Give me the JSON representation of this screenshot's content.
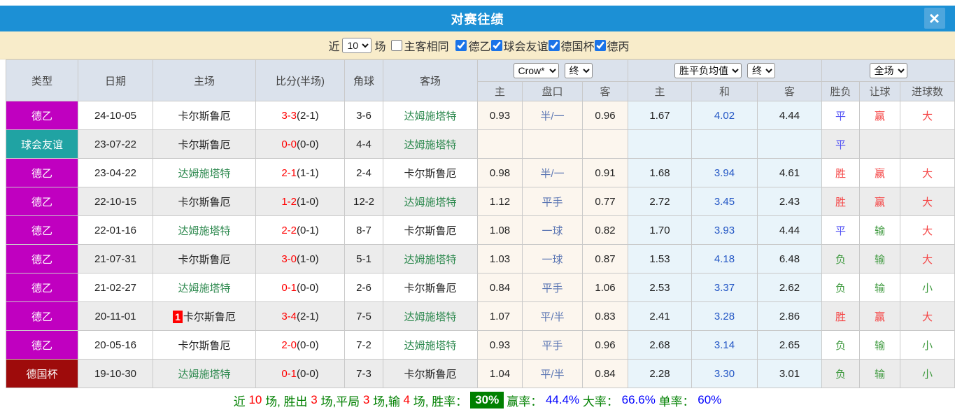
{
  "title": "对赛往绩",
  "close_glyph": "×",
  "filter": {
    "recent_label": "近",
    "recent_count": "10",
    "unit_label": "场",
    "same_home_away": {
      "label": "主客相同",
      "checked": false
    },
    "competitions": [
      {
        "label": "德乙",
        "checked": true
      },
      {
        "label": "球会友谊",
        "checked": true
      },
      {
        "label": "德国杯",
        "checked": true
      },
      {
        "label": "德丙",
        "checked": true
      }
    ]
  },
  "table": {
    "columns": {
      "type": "类型",
      "date": "日期",
      "home": "主场",
      "score": "比分(半场)",
      "corners": "角球",
      "away": "客场",
      "odds_home": "主",
      "odds_line": "盘口",
      "odds_away": "客",
      "avg_home": "主",
      "avg_draw": "和",
      "avg_away": "客",
      "result_wl": "胜负",
      "result_handicap": "让球",
      "result_goals": "进球数"
    },
    "selectors": {
      "bookmaker": "Crow*",
      "bookmaker_time": "终",
      "avg_type": "胜平负均值",
      "avg_time": "终",
      "scope": "全场"
    },
    "green_team": "达姆施塔特",
    "rows": [
      {
        "league": "德乙",
        "league_color": "#c000c0",
        "date": "24-10-05",
        "home": "卡尔斯鲁厄",
        "home_badge": "",
        "score": "3-3",
        "half": "(2-1)",
        "corners": "3-6",
        "away": "达姆施塔特",
        "odds_home": "0.93",
        "odds_line": "半/一",
        "odds_away": "0.96",
        "avg_home": "1.67",
        "avg_draw": "4.02",
        "avg_away": "4.44",
        "result_wl": "平",
        "result_handicap": "赢",
        "result_goals": "大"
      },
      {
        "league": "球会友谊",
        "league_color": "#20a3a3",
        "date": "23-07-22",
        "home": "卡尔斯鲁厄",
        "home_badge": "",
        "score": "0-0",
        "half": "(0-0)",
        "corners": "4-4",
        "away": "达姆施塔特",
        "odds_home": "",
        "odds_line": "",
        "odds_away": "",
        "avg_home": "",
        "avg_draw": "",
        "avg_away": "",
        "result_wl": "平",
        "result_handicap": "",
        "result_goals": ""
      },
      {
        "league": "德乙",
        "league_color": "#c000c0",
        "date": "23-04-22",
        "home": "达姆施塔特",
        "home_badge": "",
        "score": "2-1",
        "half": "(1-1)",
        "corners": "2-4",
        "away": "卡尔斯鲁厄",
        "odds_home": "0.98",
        "odds_line": "半/一",
        "odds_away": "0.91",
        "avg_home": "1.68",
        "avg_draw": "3.94",
        "avg_away": "4.61",
        "result_wl": "胜",
        "result_handicap": "赢",
        "result_goals": "大"
      },
      {
        "league": "德乙",
        "league_color": "#c000c0",
        "date": "22-10-15",
        "home": "卡尔斯鲁厄",
        "home_badge": "",
        "score": "1-2",
        "half": "(1-0)",
        "corners": "12-2",
        "away": "达姆施塔特",
        "odds_home": "1.12",
        "odds_line": "平手",
        "odds_away": "0.77",
        "avg_home": "2.72",
        "avg_draw": "3.45",
        "avg_away": "2.43",
        "result_wl": "胜",
        "result_handicap": "赢",
        "result_goals": "大"
      },
      {
        "league": "德乙",
        "league_color": "#c000c0",
        "date": "22-01-16",
        "home": "达姆施塔特",
        "home_badge": "",
        "score": "2-2",
        "half": "(0-1)",
        "corners": "8-7",
        "away": "卡尔斯鲁厄",
        "odds_home": "1.08",
        "odds_line": "一球",
        "odds_away": "0.82",
        "avg_home": "1.70",
        "avg_draw": "3.93",
        "avg_away": "4.44",
        "result_wl": "平",
        "result_handicap": "输",
        "result_goals": "大"
      },
      {
        "league": "德乙",
        "league_color": "#c000c0",
        "date": "21-07-31",
        "home": "卡尔斯鲁厄",
        "home_badge": "",
        "score": "3-0",
        "half": "(1-0)",
        "corners": "5-1",
        "away": "达姆施塔特",
        "odds_home": "1.03",
        "odds_line": "一球",
        "odds_away": "0.87",
        "avg_home": "1.53",
        "avg_draw": "4.18",
        "avg_away": "6.48",
        "result_wl": "负",
        "result_handicap": "输",
        "result_goals": "大"
      },
      {
        "league": "德乙",
        "league_color": "#c000c0",
        "date": "21-02-27",
        "home": "达姆施塔特",
        "home_badge": "",
        "score": "0-1",
        "half": "(0-0)",
        "corners": "2-6",
        "away": "卡尔斯鲁厄",
        "odds_home": "0.84",
        "odds_line": "平手",
        "odds_away": "1.06",
        "avg_home": "2.53",
        "avg_draw": "3.37",
        "avg_away": "2.62",
        "result_wl": "负",
        "result_handicap": "输",
        "result_goals": "小"
      },
      {
        "league": "德乙",
        "league_color": "#c000c0",
        "date": "20-11-01",
        "home": "卡尔斯鲁厄",
        "home_badge": "1",
        "score": "3-4",
        "half": "(2-1)",
        "corners": "7-5",
        "away": "达姆施塔特",
        "odds_home": "1.07",
        "odds_line": "平/半",
        "odds_away": "0.83",
        "avg_home": "2.41",
        "avg_draw": "3.28",
        "avg_away": "2.86",
        "result_wl": "胜",
        "result_handicap": "赢",
        "result_goals": "大"
      },
      {
        "league": "德乙",
        "league_color": "#c000c0",
        "date": "20-05-16",
        "home": "卡尔斯鲁厄",
        "home_badge": "",
        "score": "2-0",
        "half": "(0-0)",
        "corners": "7-2",
        "away": "达姆施塔特",
        "odds_home": "0.93",
        "odds_line": "平手",
        "odds_away": "0.96",
        "avg_home": "2.68",
        "avg_draw": "3.14",
        "avg_away": "2.65",
        "result_wl": "负",
        "result_handicap": "输",
        "result_goals": "小"
      },
      {
        "league": "德国杯",
        "league_color": "#9e0b0b",
        "date": "19-10-30",
        "home": "达姆施塔特",
        "home_badge": "",
        "score": "0-1",
        "half": "(0-0)",
        "corners": "7-3",
        "away": "卡尔斯鲁厄",
        "odds_home": "1.04",
        "odds_line": "平/半",
        "odds_away": "0.84",
        "avg_home": "2.28",
        "avg_draw": "3.30",
        "avg_away": "3.01",
        "result_wl": "负",
        "result_handicap": "输",
        "result_goals": "小"
      }
    ]
  },
  "footer": {
    "segments": [
      {
        "text": "近 ",
        "style": "green"
      },
      {
        "text": "10",
        "style": "red"
      },
      {
        "text": " 场, 胜出 ",
        "style": "green"
      },
      {
        "text": "3",
        "style": "red"
      },
      {
        "text": " 场,平局 ",
        "style": "green"
      },
      {
        "text": "3",
        "style": "red"
      },
      {
        "text": " 场,输 ",
        "style": "green"
      },
      {
        "text": "4",
        "style": "red"
      },
      {
        "text": " 场, 胜率：",
        "style": "green"
      },
      {
        "text": "30%",
        "style": "badge"
      },
      {
        "text": "赢率： ",
        "style": "green"
      },
      {
        "text": "44.4%",
        "style": "blue"
      },
      {
        "text": " 大率： ",
        "style": "green"
      },
      {
        "text": "66.6%",
        "style": "blue"
      },
      {
        "text": " 单率： ",
        "style": "green"
      },
      {
        "text": "60%",
        "style": "blue"
      }
    ]
  },
  "colors": {
    "title_bar": "#1c90d5",
    "close_button": "#4ea6dd",
    "filter_bar": "#f8ecca",
    "header_bg": "#dbe2ec",
    "row_alt": "#ececec",
    "odds_col_bg": "#fcf6ee",
    "avg_col_bg": "#e9f4fa",
    "league_de2": "#c000c0",
    "league_friendly": "#20a3a3",
    "league_cup": "#9e0b0b",
    "team_green": "#2f8a50",
    "score_red": "#ff0000",
    "win_red": "#f54545",
    "draw_violet": "#5151f5",
    "lose_green": "#3f9a3f",
    "footer_green": "#008000",
    "footer_blue": "#0000ff",
    "rate_badge_green": "#008000"
  }
}
